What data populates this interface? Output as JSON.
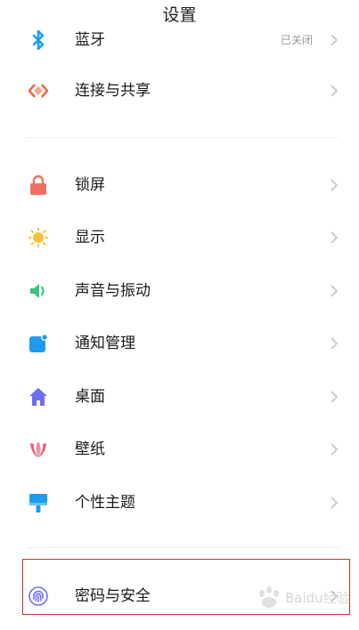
{
  "header": {
    "title": "设置"
  },
  "top_partial": {
    "label": "蓝牙",
    "value": "已关闭"
  },
  "group1": [
    {
      "label": "连接与共享",
      "icon": "share-connect-icon"
    }
  ],
  "group2": [
    {
      "label": "锁屏",
      "icon": "lock-icon",
      "color": "#f0705f"
    },
    {
      "label": "显示",
      "icon": "sun-icon",
      "color": "#f6c23d"
    },
    {
      "label": "声音与振动",
      "icon": "speaker-icon",
      "color": "#39c67a"
    },
    {
      "label": "通知管理",
      "icon": "notification-icon",
      "color": "#1d9bf0"
    },
    {
      "label": "桌面",
      "icon": "home-icon",
      "color": "#6e6ef0"
    },
    {
      "label": "壁纸",
      "icon": "tulip-icon",
      "color": "#ea5d7b"
    },
    {
      "label": "个性主题",
      "icon": "paint-brush-icon",
      "color": "#1d9bf0"
    }
  ],
  "group3": [
    {
      "label": "密码与安全",
      "icon": "fingerprint-icon",
      "color": "#6e6ef0"
    }
  ],
  "watermark": {
    "text": "Baidu经验"
  }
}
